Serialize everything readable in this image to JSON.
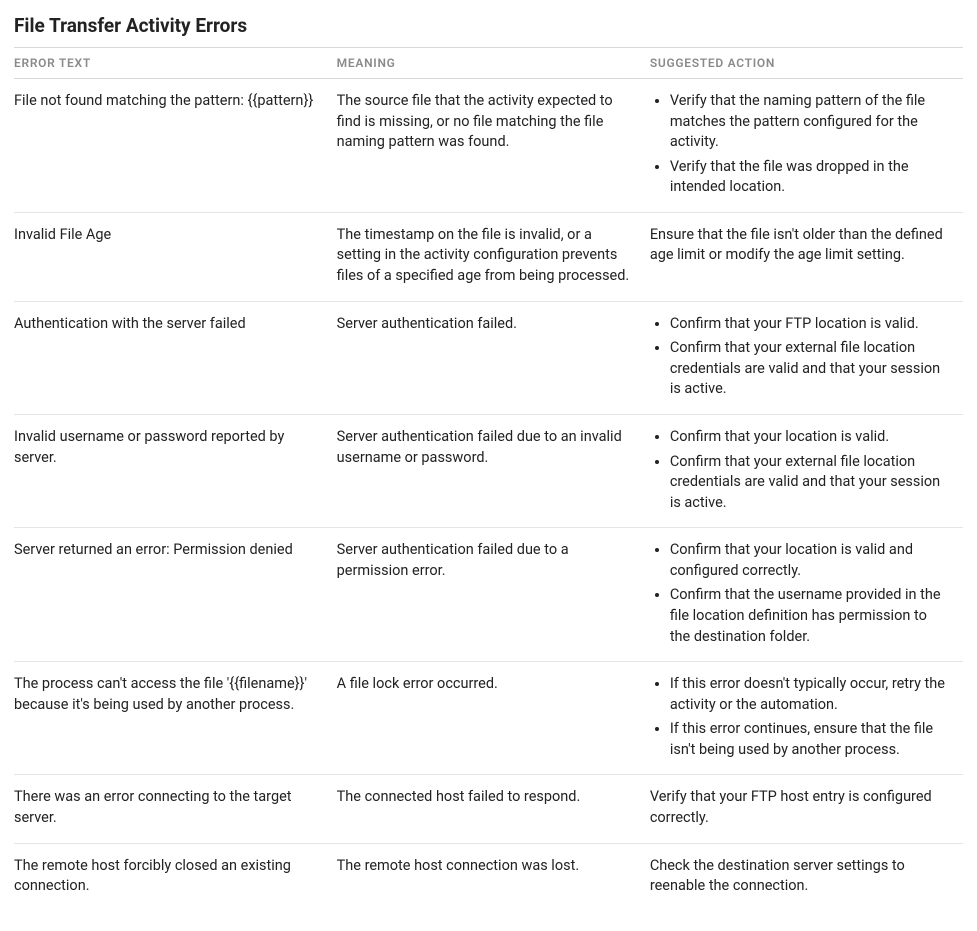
{
  "title": "File Transfer Activity Errors",
  "columns": {
    "error_text": "ERROR TEXT",
    "meaning": "MEANING",
    "suggested_action": "SUGGESTED ACTION"
  },
  "rows": [
    {
      "error_text": "File not found matching the pattern: {{pattern}}",
      "meaning": "The source file that the activity expected to find is missing, or no file matching the file naming pattern was found.",
      "action_type": "list",
      "actions": [
        "Verify that the naming pattern of the file matches the pattern configured for the activity.",
        "Verify that the file was dropped in the intended location."
      ]
    },
    {
      "error_text": "Invalid File Age",
      "meaning": "The timestamp on the file is invalid, or a setting in the activity configuration prevents files of a specified age from being processed.",
      "action_type": "text",
      "action_text": "Ensure that the file isn't older than the defined age limit or modify the age limit setting."
    },
    {
      "error_text": "Authentication with the server failed",
      "meaning": "Server authentication failed.",
      "action_type": "list",
      "actions": [
        "Confirm that your FTP location is valid.",
        "Confirm that your external file location credentials are valid and that your session is active."
      ]
    },
    {
      "error_text": "Invalid username or password reported by server.",
      "meaning": "Server authentication failed due to an invalid username or password.",
      "action_type": "list",
      "actions": [
        "Confirm that your location is valid.",
        "Confirm that your external file location credentials are valid and that your session is active."
      ]
    },
    {
      "error_text": "Server returned an error: Permission denied",
      "meaning": "Server authentication failed due to a permission error.",
      "action_type": "list",
      "actions": [
        "Confirm that your location is valid and configured correctly.",
        "Confirm that the username provided in the file location definition has permission to the destination folder."
      ]
    },
    {
      "error_text": "The process can't access the file '{{filename}}' because it's being used by another process.",
      "meaning": "A file lock error occurred.",
      "action_type": "list",
      "actions": [
        "If this error doesn't typically occur, retry the activity or the automation.",
        "If this error continues, ensure that the file isn't being used by another process."
      ]
    },
    {
      "error_text": "There was an error connecting to the target server.",
      "meaning": "The connected host failed to respond.",
      "action_type": "text",
      "action_text": "Verify that your FTP host entry is configured correctly."
    },
    {
      "error_text": "The remote host forcibly closed an existing connection.",
      "meaning": "The remote host connection was lost.",
      "action_type": "text",
      "action_text": "Check the destination server settings to reenable the connection."
    }
  ]
}
